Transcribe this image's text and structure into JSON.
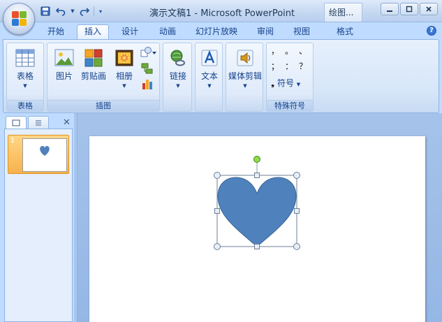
{
  "window": {
    "title": "演示文稿1 - Microsoft PowerPoint",
    "context_tool": "绘图..."
  },
  "tabs": [
    {
      "label": "开始",
      "active": false
    },
    {
      "label": "插入",
      "active": true
    },
    {
      "label": "设计",
      "active": false
    },
    {
      "label": "动画",
      "active": false
    },
    {
      "label": "幻灯片放映",
      "active": false
    },
    {
      "label": "审阅",
      "active": false
    },
    {
      "label": "视图",
      "active": false
    },
    {
      "label": "格式",
      "active": false
    }
  ],
  "ribbon": {
    "groups": {
      "tables": {
        "label": "表格",
        "buttons": {
          "table": "表格"
        }
      },
      "illustrations": {
        "label": "插图",
        "buttons": {
          "picture": "图片",
          "clipart": "剪贴画",
          "album": "相册"
        }
      },
      "links": {
        "buttons": {
          "link": "链接"
        }
      },
      "text": {
        "buttons": {
          "text": "文本"
        }
      },
      "media": {
        "buttons": {
          "media": "媒体剪辑"
        }
      },
      "symbols": {
        "label": "特殊符号",
        "symbol_button": "符号",
        "chars": [
          "，",
          "。",
          "、",
          "；",
          "：",
          "？"
        ]
      }
    }
  },
  "slides_panel": {
    "slides": [
      {
        "number": "1"
      }
    ]
  },
  "colors": {
    "heart_fill": "#4f81bd",
    "heart_stroke": "#3a6593",
    "thumb_selected": "#f7b24d",
    "accent": "#15428b"
  },
  "icons": {
    "office": "office-button-icon",
    "save": "save-icon",
    "undo": "undo-icon",
    "redo": "redo-icon",
    "help": "help-icon"
  }
}
